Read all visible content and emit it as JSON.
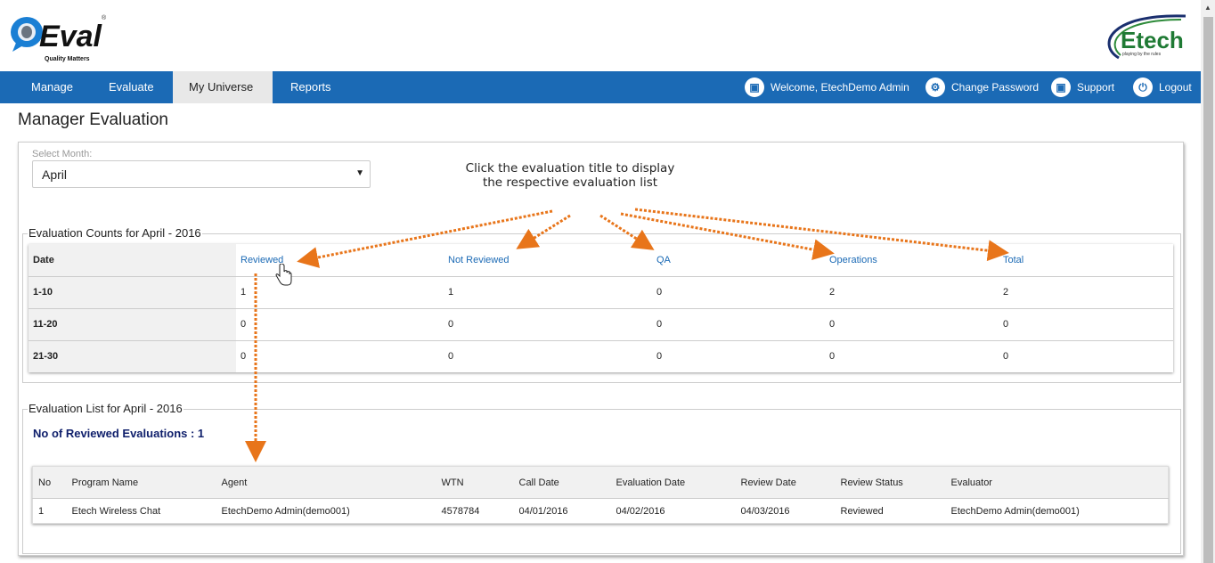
{
  "header": {
    "logo_left": "QEval",
    "logo_left_tagline": "Quality Matters",
    "logo_right": "Etech",
    "logo_right_tagline": "playing by the rules"
  },
  "nav": {
    "items": [
      {
        "label": "Manage",
        "active": false
      },
      {
        "label": "Evaluate",
        "active": false
      },
      {
        "label": "My Universe",
        "active": true
      },
      {
        "label": "Reports",
        "active": false
      }
    ],
    "right": [
      {
        "icon": "user-badge-icon",
        "label": "Welcome, EtechDemo Admin"
      },
      {
        "icon": "gear-icon",
        "label": "Change Password"
      },
      {
        "icon": "support-icon",
        "label": "Support"
      },
      {
        "icon": "power-icon",
        "label": "Logout"
      }
    ]
  },
  "page": {
    "title": "Manager Evaluation",
    "month_label": "Select Month:",
    "month_value": "April",
    "annotation_line1": "Click the evaluation title to display",
    "annotation_line2": "the respective evaluation list"
  },
  "counts": {
    "legend": "Evaluation Counts for April - 2016",
    "headers": [
      "Date",
      "Reviewed",
      "Not Reviewed",
      "QA",
      "Operations",
      "Total"
    ],
    "rows": [
      [
        "1-10",
        "1",
        "1",
        "0",
        "2",
        "2"
      ],
      [
        "11-20",
        "0",
        "0",
        "0",
        "0",
        "0"
      ],
      [
        "21-30",
        "0",
        "0",
        "0",
        "0",
        "0"
      ]
    ]
  },
  "list": {
    "legend": "Evaluation List for April - 2016",
    "count_label": "No of Reviewed Evaluations : 1",
    "headers": [
      "No",
      "Program Name",
      "Agent",
      "WTN",
      "Call Date",
      "Evaluation Date",
      "Review Date",
      "Review Status",
      "Evaluator"
    ],
    "rows": [
      [
        "1",
        "Etech Wireless Chat",
        "EtechDemo Admin(demo001)",
        "4578784",
        "04/01/2016",
        "04/02/2016",
        "04/03/2016",
        "Reviewed",
        "EtechDemo Admin(demo001)"
      ]
    ]
  },
  "colors": {
    "nav_bg": "#1b6ab5",
    "link": "#1b6ab5",
    "arrow": "#e8751a",
    "count_text": "#0f1f6b"
  }
}
